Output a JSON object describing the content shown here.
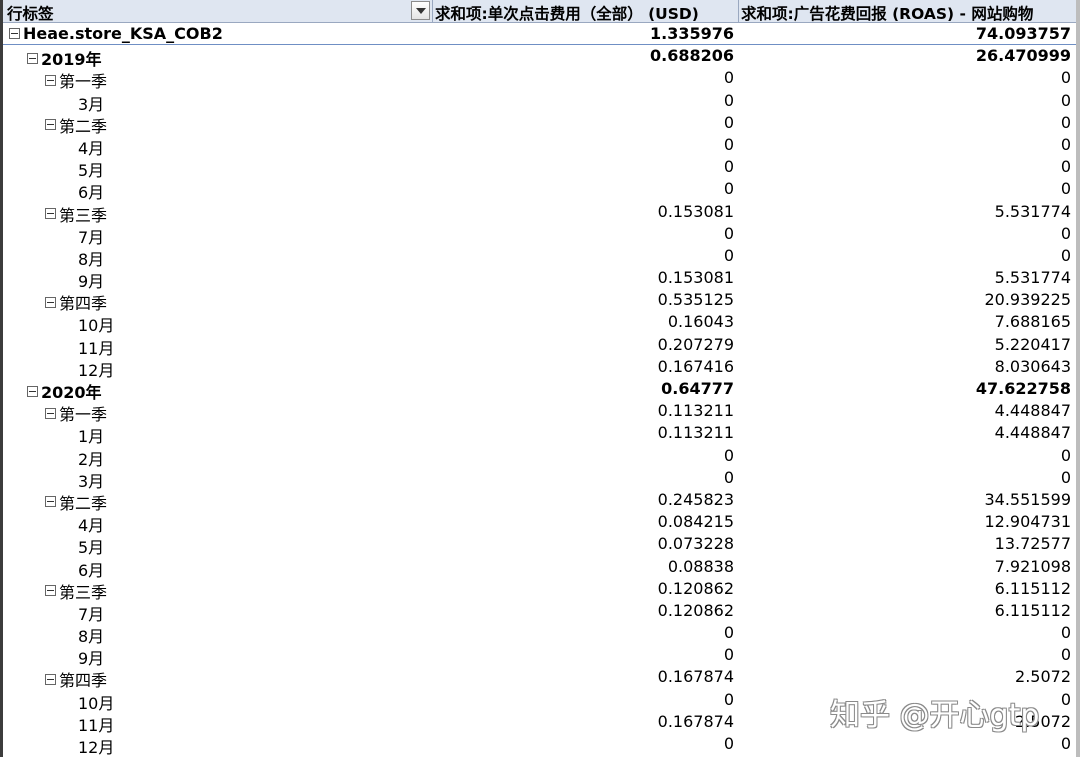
{
  "header": {
    "row_label": "行标签",
    "col1": "求和项:单次点击费用（全部） (USD)",
    "col2": "求和项:广告花费回报 (ROAS) - 网站购物"
  },
  "rows": [
    {
      "label": "Heae.store_KSA_COB2",
      "v1": "1.335976",
      "v2": "74.093757"
    },
    {
      "label": "2019年",
      "v1": "0.688206",
      "v2": "26.470999"
    },
    {
      "label": "第一季",
      "v1": "0",
      "v2": "0"
    },
    {
      "label": "3月",
      "v1": "0",
      "v2": "0"
    },
    {
      "label": "第二季",
      "v1": "0",
      "v2": "0"
    },
    {
      "label": "4月",
      "v1": "0",
      "v2": "0"
    },
    {
      "label": "5月",
      "v1": "0",
      "v2": "0"
    },
    {
      "label": "6月",
      "v1": "0",
      "v2": "0"
    },
    {
      "label": "第三季",
      "v1": "0.153081",
      "v2": "5.531774"
    },
    {
      "label": "7月",
      "v1": "0",
      "v2": "0"
    },
    {
      "label": "8月",
      "v1": "0",
      "v2": "0"
    },
    {
      "label": "9月",
      "v1": "0.153081",
      "v2": "5.531774"
    },
    {
      "label": "第四季",
      "v1": "0.535125",
      "v2": "20.939225"
    },
    {
      "label": "10月",
      "v1": "0.16043",
      "v2": "7.688165"
    },
    {
      "label": "11月",
      "v1": "0.207279",
      "v2": "5.220417"
    },
    {
      "label": "12月",
      "v1": "0.167416",
      "v2": "8.030643"
    },
    {
      "label": "2020年",
      "v1": "0.64777",
      "v2": "47.622758"
    },
    {
      "label": "第一季",
      "v1": "0.113211",
      "v2": "4.448847"
    },
    {
      "label": "1月",
      "v1": "0.113211",
      "v2": "4.448847"
    },
    {
      "label": "2月",
      "v1": "0",
      "v2": "0"
    },
    {
      "label": "3月",
      "v1": "0",
      "v2": "0"
    },
    {
      "label": "第二季",
      "v1": "0.245823",
      "v2": "34.551599"
    },
    {
      "label": "4月",
      "v1": "0.084215",
      "v2": "12.904731"
    },
    {
      "label": "5月",
      "v1": "0.073228",
      "v2": "13.72577"
    },
    {
      "label": "6月",
      "v1": "0.08838",
      "v2": "7.921098"
    },
    {
      "label": "第三季",
      "v1": "0.120862",
      "v2": "6.115112"
    },
    {
      "label": "7月",
      "v1": "0.120862",
      "v2": "6.115112"
    },
    {
      "label": "8月",
      "v1": "0",
      "v2": "0"
    },
    {
      "label": "9月",
      "v1": "0",
      "v2": "0"
    },
    {
      "label": "第四季",
      "v1": "0.167874",
      "v2": "2.5072"
    },
    {
      "label": "10月",
      "v1": "0",
      "v2": "0"
    },
    {
      "label": "11月",
      "v1": "0.167874",
      "v2": "2.5072"
    },
    {
      "label": "12月",
      "v1": "0",
      "v2": "0"
    }
  ],
  "watermark": "知乎 @开心gtp"
}
